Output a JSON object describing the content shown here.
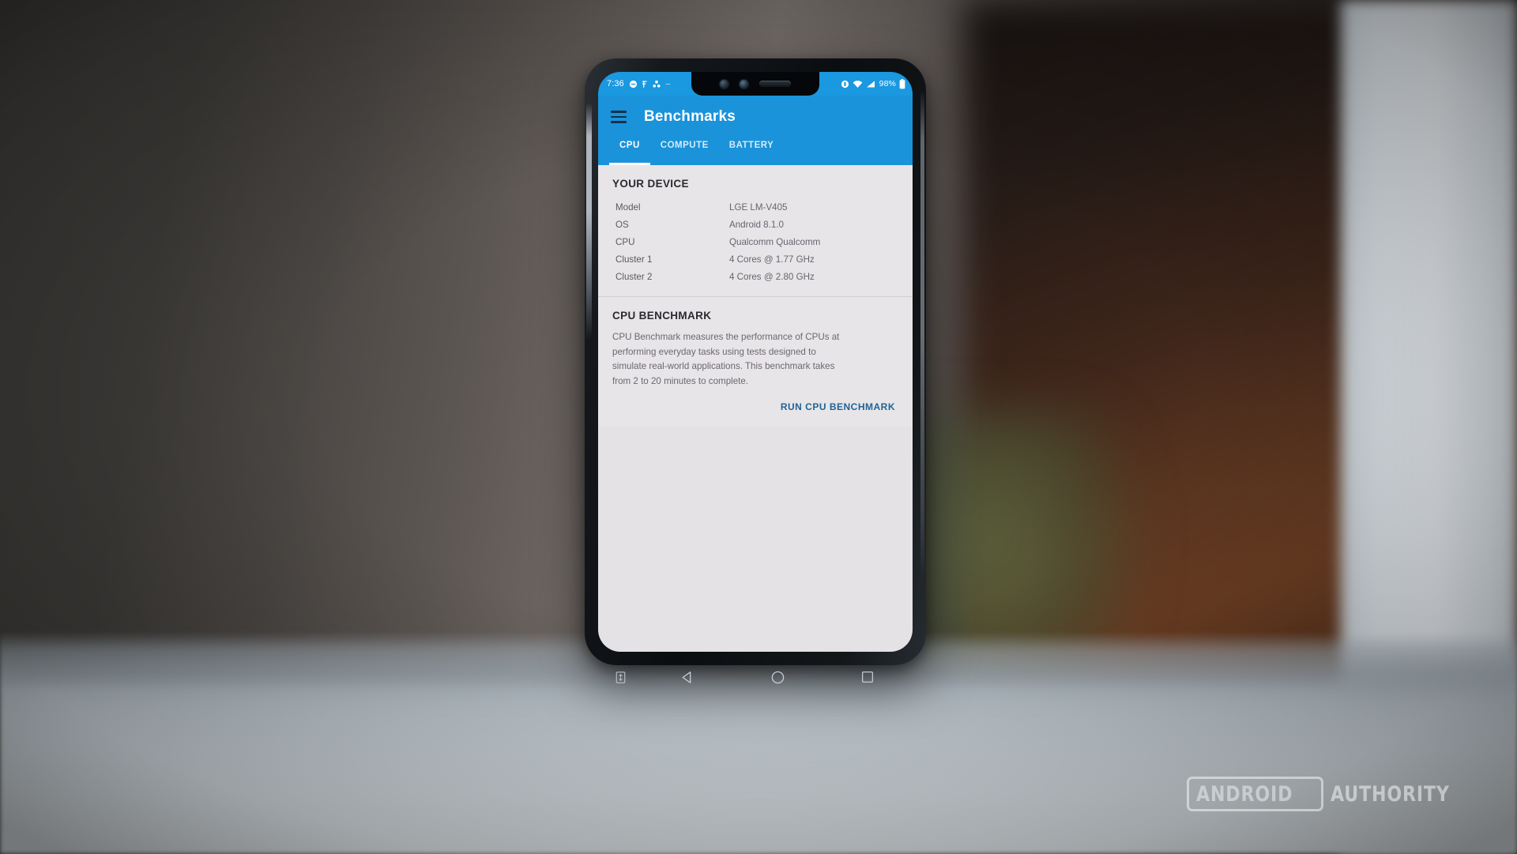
{
  "status_bar": {
    "clock": "7:36",
    "left_icons": [
      "dnd-icon",
      "hearing-aid-icon",
      "bluetooth-share-icon"
    ],
    "right_icons": [
      "vibrate-icon",
      "wifi-icon",
      "signal-icon"
    ],
    "battery_percent": "98%",
    "battery_icon": "battery-full-icon",
    "background_color": "#1a98e0"
  },
  "app_bar": {
    "menu_icon": "hamburger-menu-icon",
    "title": "Benchmarks",
    "background_color": "#1a93da"
  },
  "tabs": {
    "items": [
      {
        "label": "CPU",
        "active": true
      },
      {
        "label": "COMPUTE",
        "active": false
      },
      {
        "label": "BATTERY",
        "active": false
      }
    ],
    "indicator_color": "#ffffff"
  },
  "device_card": {
    "title": "YOUR DEVICE",
    "rows": [
      {
        "key": "Model",
        "value": "LGE LM-V405"
      },
      {
        "key": "OS",
        "value": "Android 8.1.0"
      },
      {
        "key": "CPU",
        "value": "Qualcomm Qualcomm"
      },
      {
        "key": "Cluster 1",
        "value": "4 Cores @ 1.77 GHz"
      },
      {
        "key": "Cluster 2",
        "value": "4 Cores @ 2.80 GHz"
      }
    ]
  },
  "benchmark_card": {
    "title": "CPU BENCHMARK",
    "description": "CPU Benchmark measures the performance of CPUs at performing everyday tasks using tests designed to simulate real-world applications. This benchmark takes from 2 to 20 minutes to complete.",
    "action_label": "RUN CPU BENCHMARK",
    "action_color": "#1f6397"
  },
  "navigation_bar": {
    "buttons": [
      "screen-pin-icon",
      "back-icon",
      "home-icon",
      "recents-icon"
    ]
  },
  "watermark": {
    "boxed_word": "ANDROID",
    "plain_word": "AUTHORITY"
  }
}
